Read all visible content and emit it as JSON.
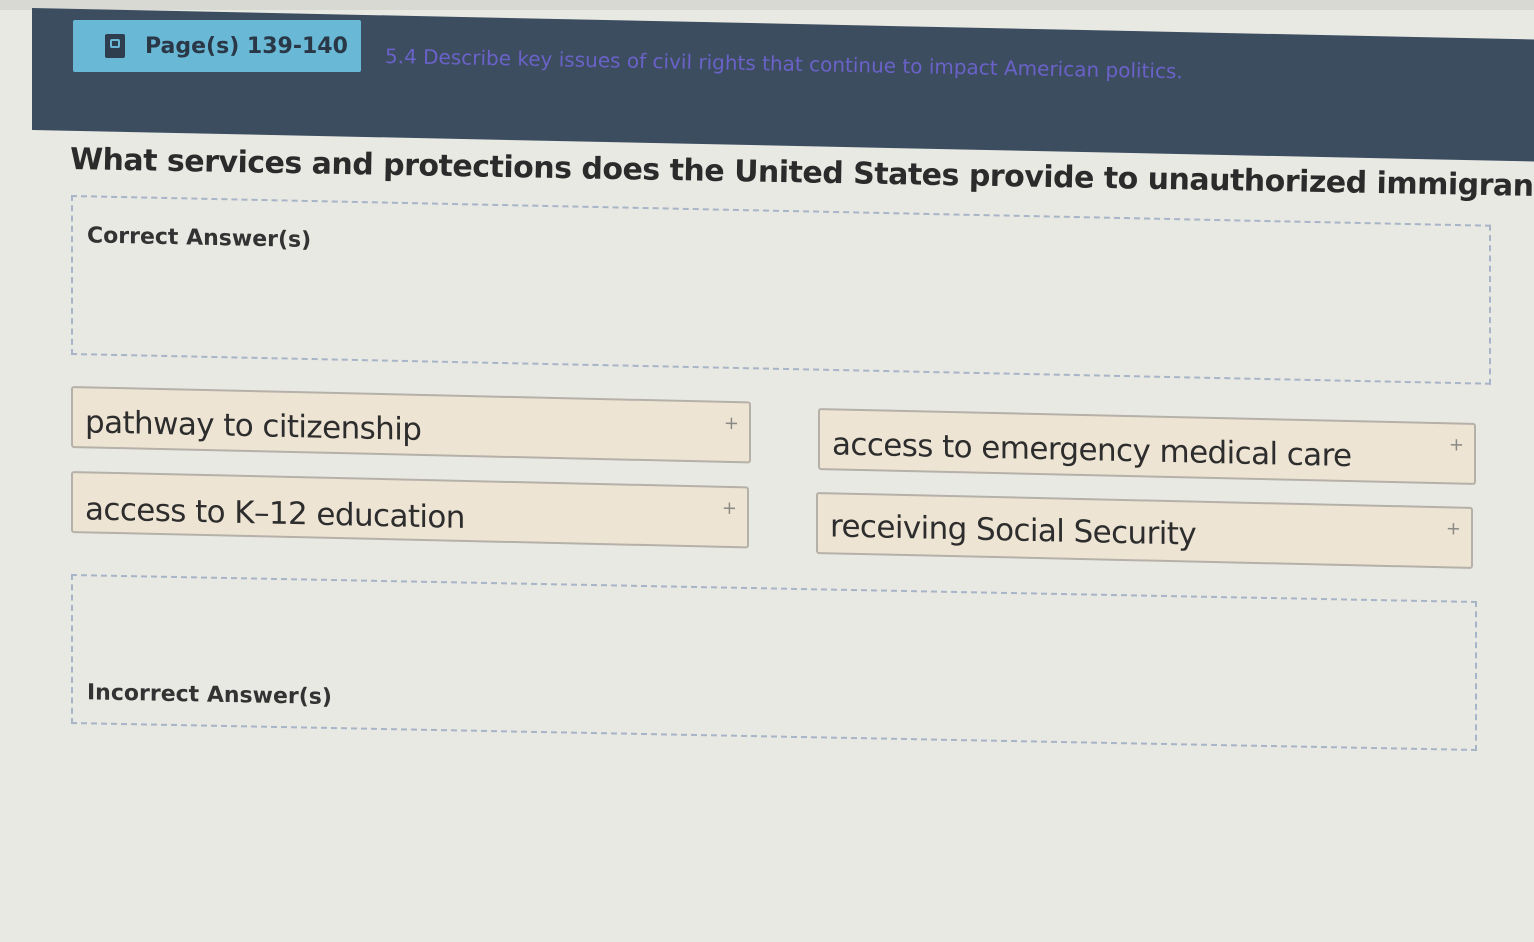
{
  "header": {
    "page_label": "Page(s) 139-140",
    "objective": "5.4 Describe key issues of civil rights that continue to impact American politics."
  },
  "question": {
    "text": "What services and protections does the United States provide to unauthorized immigrants?"
  },
  "zones": {
    "correct_label": "Correct Answer(s)",
    "incorrect_label": "Incorrect Answer(s)"
  },
  "answers": [
    {
      "label": "pathway to citizenship",
      "icon": "plus-icon"
    },
    {
      "label": "access to emergency medical care",
      "icon": "plus-icon"
    },
    {
      "label": "access to K–12 education",
      "icon": "plus-icon"
    },
    {
      "label": "receiving Social Security",
      "icon": "plus-icon"
    }
  ],
  "icons": {
    "book": "book-icon",
    "plus": "+"
  },
  "colors": {
    "header_bg": "#3c4d60",
    "badge_bg": "#68b8d6",
    "objective_text": "#6a62c8",
    "tile_bg": "#ede4d4",
    "zone_border": "#a8b4c8"
  }
}
